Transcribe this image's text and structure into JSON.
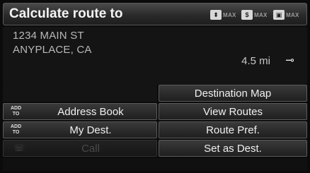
{
  "header": {
    "title": "Calculate route to",
    "modes": [
      {
        "icon": "traffic-icon",
        "label": "MAX"
      },
      {
        "icon": "dollar-icon",
        "label": "MAX"
      },
      {
        "icon": "lock-icon",
        "label": "MAX"
      }
    ]
  },
  "destination": {
    "street": "1234 MAIN ST",
    "city": "ANYPLACE, CA",
    "distance": "4.5 mi"
  },
  "buttons": {
    "destination_map": "Destination Map",
    "address_book": "Address Book",
    "view_routes": "View Routes",
    "my_dest": "My Dest.",
    "route_pref": "Route Pref.",
    "call": "Call",
    "set_as_dest": "Set as Dest."
  },
  "badges": {
    "add_to": "ADD TO"
  }
}
